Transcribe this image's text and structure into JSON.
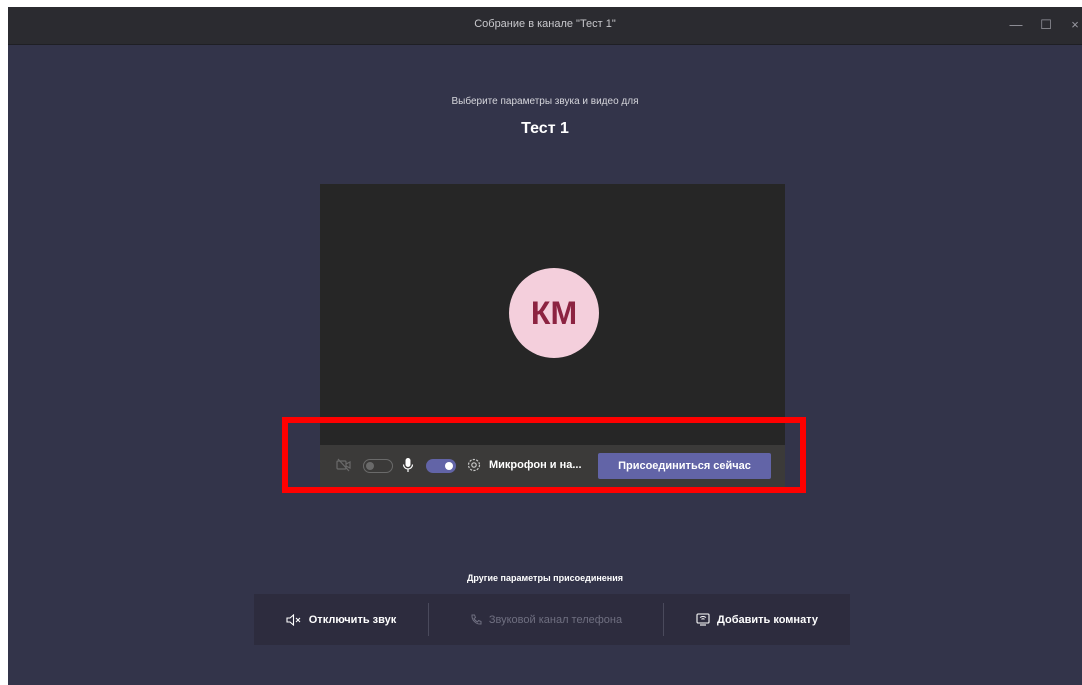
{
  "window": {
    "title": "Собрание в канале \"Тест 1\"",
    "controls": {
      "minimize": "—",
      "maximize": "☐",
      "close": "×"
    }
  },
  "prejoin": {
    "subtitle": "Выберите параметры звука и видео для",
    "meeting_name": "Тест 1",
    "avatar_initials": "КМ",
    "camera_enabled": false,
    "mic_enabled": true,
    "device_settings_label": "Микрофон и на...",
    "join_button": "Присоединиться сейчас"
  },
  "other_options": {
    "heading": "Другие параметры присоединения",
    "items": [
      {
        "label": "Отключить звук",
        "icon": "speaker-mute-icon",
        "enabled": true
      },
      {
        "label": "Звуковой канал телефона",
        "icon": "phone-icon",
        "enabled": false
      },
      {
        "label": "Добавить комнату",
        "icon": "room-display-icon",
        "enabled": true
      }
    ]
  },
  "colors": {
    "background": "#33344a",
    "accent": "#6264a7",
    "avatar_bg": "#f4cfdc",
    "avatar_text": "#8c2341",
    "highlight": "#ff0000"
  }
}
